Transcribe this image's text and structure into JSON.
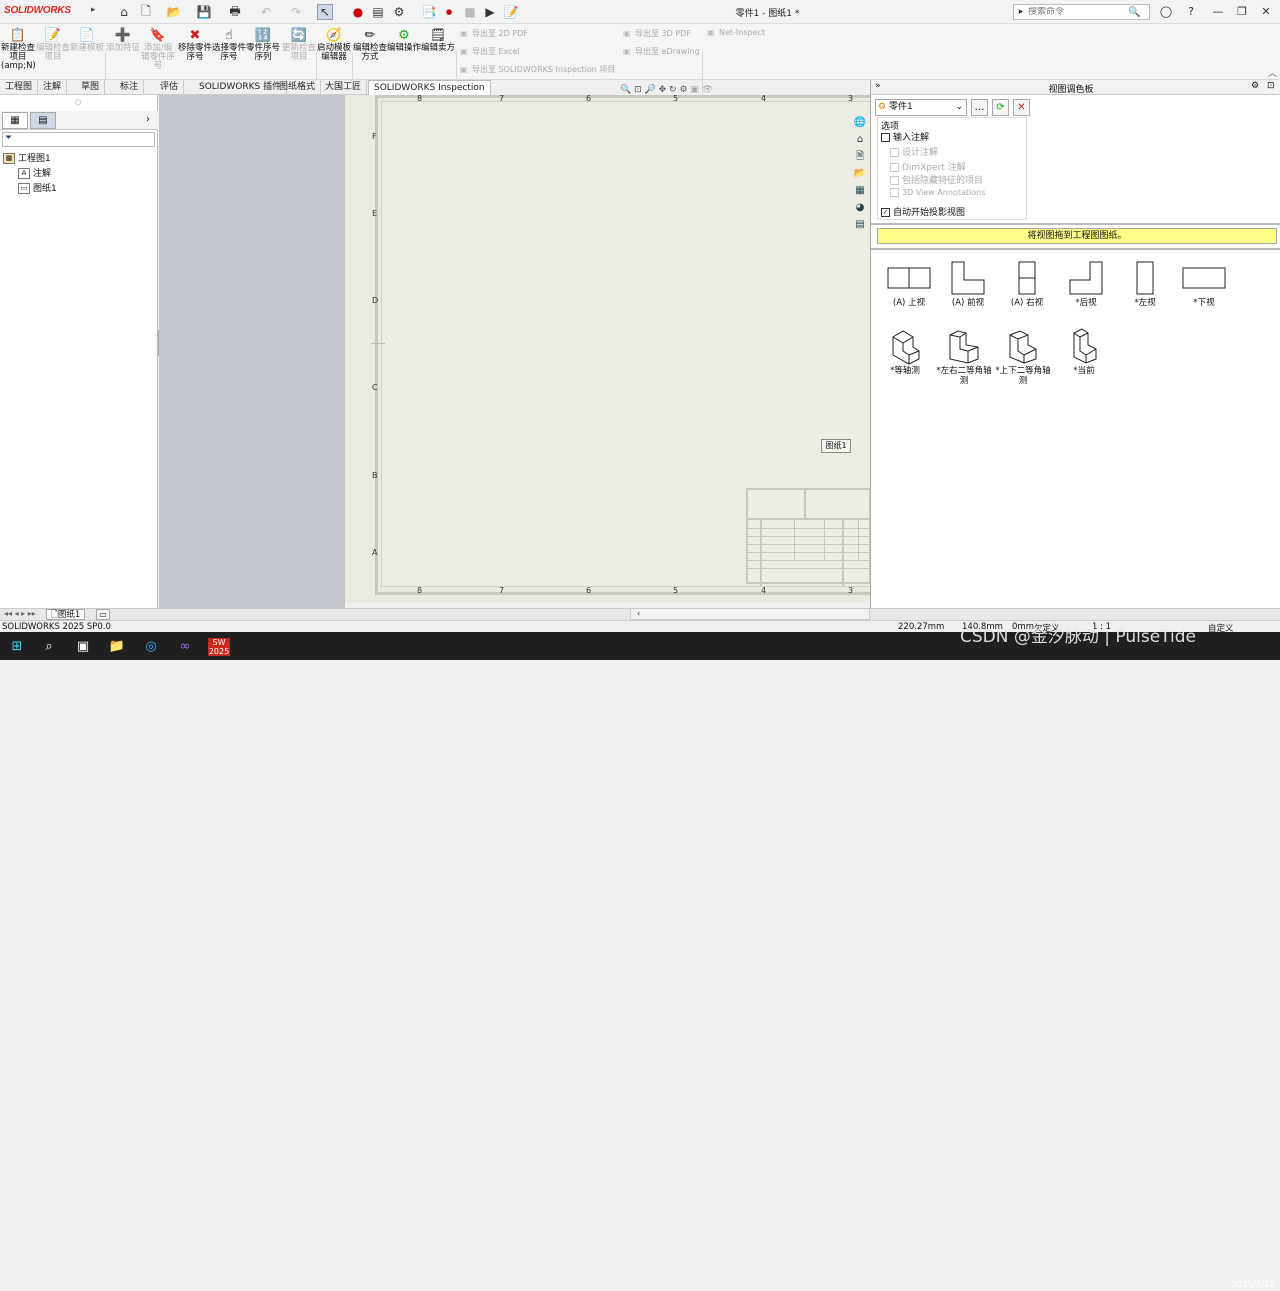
{
  "app": {
    "brand": "SOLIDWORKS",
    "window_title": "零件1 - 图纸1 *"
  },
  "search": {
    "placeholder": "搜索命令"
  },
  "ribbon": {
    "buttons": [
      {
        "label": "新建检查项目",
        "sub": "(amp;N)",
        "icon": "📋",
        "enabled": true
      },
      {
        "label": "编辑检查项目",
        "icon": "📝",
        "enabled": false
      },
      {
        "label": "新建模板",
        "icon": "📄",
        "enabled": false
      },
      {
        "label": "添加特征",
        "icon": "➕",
        "enabled": false
      },
      {
        "label": "添加/编辑零件序号",
        "icon": "🔖",
        "enabled": false
      },
      {
        "label": "移除零件序号",
        "icon": "✖",
        "enabled": true
      },
      {
        "label": "选择零件序号",
        "icon": "☝",
        "enabled": true
      },
      {
        "label": "零件序号序列",
        "icon": "🔢",
        "enabled": true
      },
      {
        "label": "更新检查项目",
        "icon": "🔄",
        "enabled": false
      },
      {
        "label": "启动模板编辑器",
        "icon": "🧭",
        "enabled": true
      },
      {
        "label": "编辑检查方式",
        "icon": "✏",
        "enabled": true
      },
      {
        "label": "编辑操作",
        "icon": "⚙",
        "enabled": true
      },
      {
        "label": "编辑卖方",
        "icon": "🗒",
        "enabled": true
      }
    ],
    "exports": [
      "导出至 2D PDF",
      "导出至 Excel",
      "导出至 SOLIDWORKS Inspection 项目",
      "导出至 3D PDF",
      "导出至 eDrawing",
      "Net-Inspect"
    ]
  },
  "tabs": [
    "工程图",
    "注解",
    "草图",
    "标注",
    "评估",
    "SOLIDWORKS 插件",
    "图纸格式",
    "大国工匠",
    "SOLIDWORKS Inspection"
  ],
  "active_tab": "SOLIDWORKS Inspection",
  "tree": {
    "root": "工程图1",
    "items": [
      "注解",
      "图纸1"
    ]
  },
  "sheet": {
    "label": "图纸1",
    "zones_top": [
      "8",
      "7",
      "6",
      "5",
      "4",
      "3"
    ],
    "zones_bottom": [
      "8",
      "7",
      "6",
      "5",
      "4",
      "3"
    ],
    "rows": [
      "F",
      "E",
      "D",
      "C",
      "B",
      "A"
    ]
  },
  "palette": {
    "title": "视图调色板",
    "model": "零件1",
    "options_title": "选项",
    "options": [
      {
        "label": "输入注解",
        "checked": false,
        "enabled": true
      },
      {
        "label": "设计注解",
        "checked": false,
        "enabled": false
      },
      {
        "label": "DimXpert 注解",
        "checked": false,
        "enabled": false
      },
      {
        "label": "包括隐藏特征的项目",
        "checked": false,
        "enabled": false
      },
      {
        "label": "3D View Annotations",
        "checked": false,
        "enabled": false
      },
      {
        "label": "自动开始投影视图",
        "checked": true,
        "enabled": true
      }
    ],
    "hint": "将视图拖到工程图图纸。",
    "views": [
      {
        "label": "(A) 上视",
        "icon": "top"
      },
      {
        "label": "(A) 前视",
        "icon": "front"
      },
      {
        "label": "(A) 右视",
        "icon": "right"
      },
      {
        "label": "*后视",
        "icon": "back"
      },
      {
        "label": "*左视",
        "icon": "left"
      },
      {
        "label": "*下视",
        "icon": "bottom"
      },
      {
        "label": "*等轴测",
        "icon": "iso"
      },
      {
        "label": "*左右二等角轴测",
        "icon": "iso"
      },
      {
        "label": "*上下二等角轴测",
        "icon": "iso"
      },
      {
        "label": "*当前",
        "icon": "iso"
      }
    ]
  },
  "bottom": {
    "sheet_tab": "图纸1"
  },
  "status": {
    "version": "SOLIDWORKS 2025 SP0.0",
    "x": "220.27mm",
    "y": "140.8mm",
    "z": "0mm",
    "state": "欠定义",
    "scale": "1 : 1",
    "units": "自定义"
  },
  "taskbar": {
    "date": "2025/5/22"
  },
  "watermark": "CSDN @金汐脉动 | PulseTide"
}
